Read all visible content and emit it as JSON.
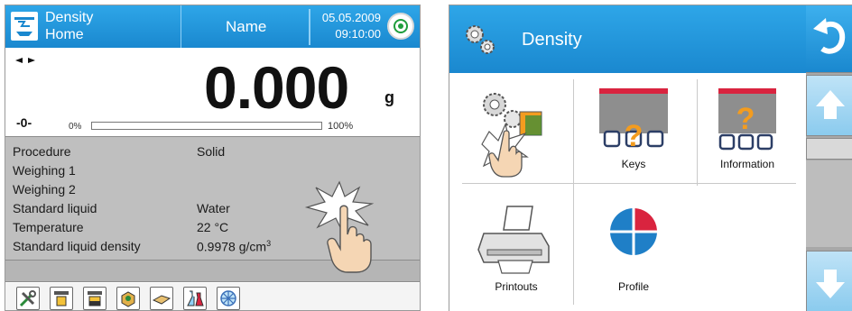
{
  "left_screen": {
    "header": {
      "title": "Density",
      "subtitle": "Home",
      "user": "Name",
      "date": "05.05.2009",
      "time": "09:10:00",
      "icons": {
        "app": "balance-pan-icon",
        "status": "level-ok-icon"
      }
    },
    "weighing": {
      "stability_marker": "stability-marker",
      "zero_indicator": "-0-",
      "value": "0.000",
      "unit": "g",
      "bargraph": {
        "min_label": "0%",
        "max_label": "100%",
        "fill_fraction": 0.0
      }
    },
    "info_rows": [
      {
        "label": "Procedure",
        "value": "Solid"
      },
      {
        "label": "Weighing 1",
        "value": ""
      },
      {
        "label": "Weighing 2",
        "value": ""
      },
      {
        "label": "Standard liquid",
        "value": "Water"
      },
      {
        "label": "Temperature",
        "value": "22 °C"
      },
      {
        "label": "Standard liquid density",
        "value": "0.9978 g/cm",
        "value_sup": "3"
      }
    ],
    "toolbar_icons": [
      "tools-icon",
      "weigh-in-air-icon",
      "weigh-in-liquid-icon",
      "sample-box-icon",
      "solid-body-icon",
      "beakers-icon",
      "stirrer-icon"
    ]
  },
  "right_screen": {
    "header": {
      "title": "Density",
      "icon": "settings-gears-icon"
    },
    "tiles": [
      {
        "label": "",
        "icon": "settings-gears-icon"
      },
      {
        "label": "Keys",
        "icon": "keys-icon"
      },
      {
        "label": "Information",
        "icon": "information-icon"
      },
      {
        "label": "Printouts",
        "icon": "printer-icon"
      },
      {
        "label": "Profile",
        "icon": "profile-icon"
      }
    ],
    "side_buttons": [
      "back-icon",
      "scroll-up-icon",
      "scroll-down-icon"
    ]
  },
  "colors": {
    "header_blue": "#1f95dc",
    "info_gray": "#bfbfbf",
    "accent_red": "#d9243f",
    "accent_orange": "#f39c1f",
    "ok_green": "#1f9d3c"
  }
}
